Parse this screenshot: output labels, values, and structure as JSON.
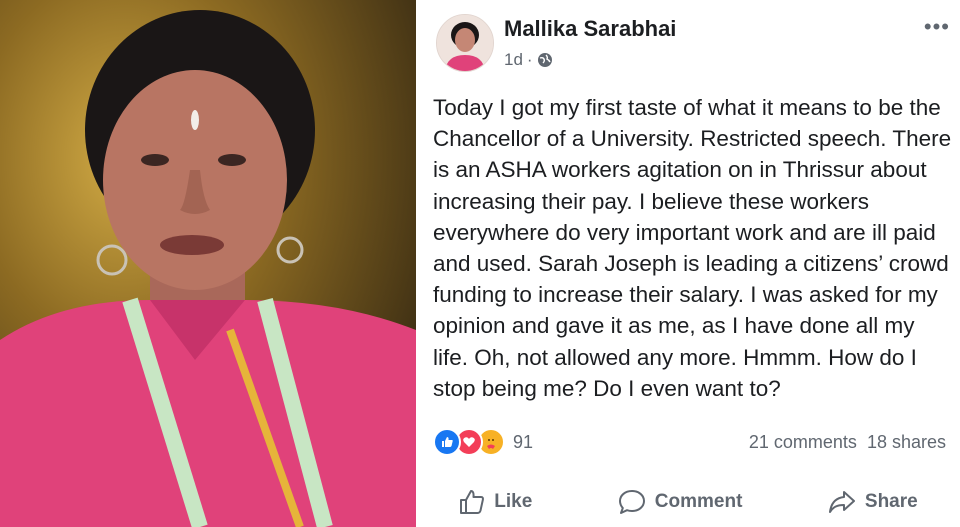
{
  "post": {
    "author": "Mallika Sarabhai",
    "time": "1d",
    "time_separator": "·",
    "more_label": "•••",
    "text": "Today I got my first taste of what it means to be the Chancellor of a University. Restricted speech. There is an ASHA workers agitation on in Thrissur about increasing their pay. I believe these workers everywhere do very important work and are ill paid and used. Sarah Joseph is leading a citizens’ crowd funding to increase their salary. I was asked for my opinion and gave it as me, as I have done all my life. Oh, not allowed any more. Hmmm. How do I stop being me? Do I even want to?",
    "reactions": {
      "icons": [
        "like-icon",
        "love-icon",
        "care-icon"
      ],
      "count": "91"
    },
    "comments": "21 comments",
    "shares": "18 shares"
  },
  "actions": {
    "like": "Like",
    "comment": "Comment",
    "share": "Share"
  },
  "colors": {
    "like": "#1877f2",
    "love": "#f33e58",
    "care": "#f7b125",
    "text": "#1c1e21",
    "secondary": "#606770"
  }
}
